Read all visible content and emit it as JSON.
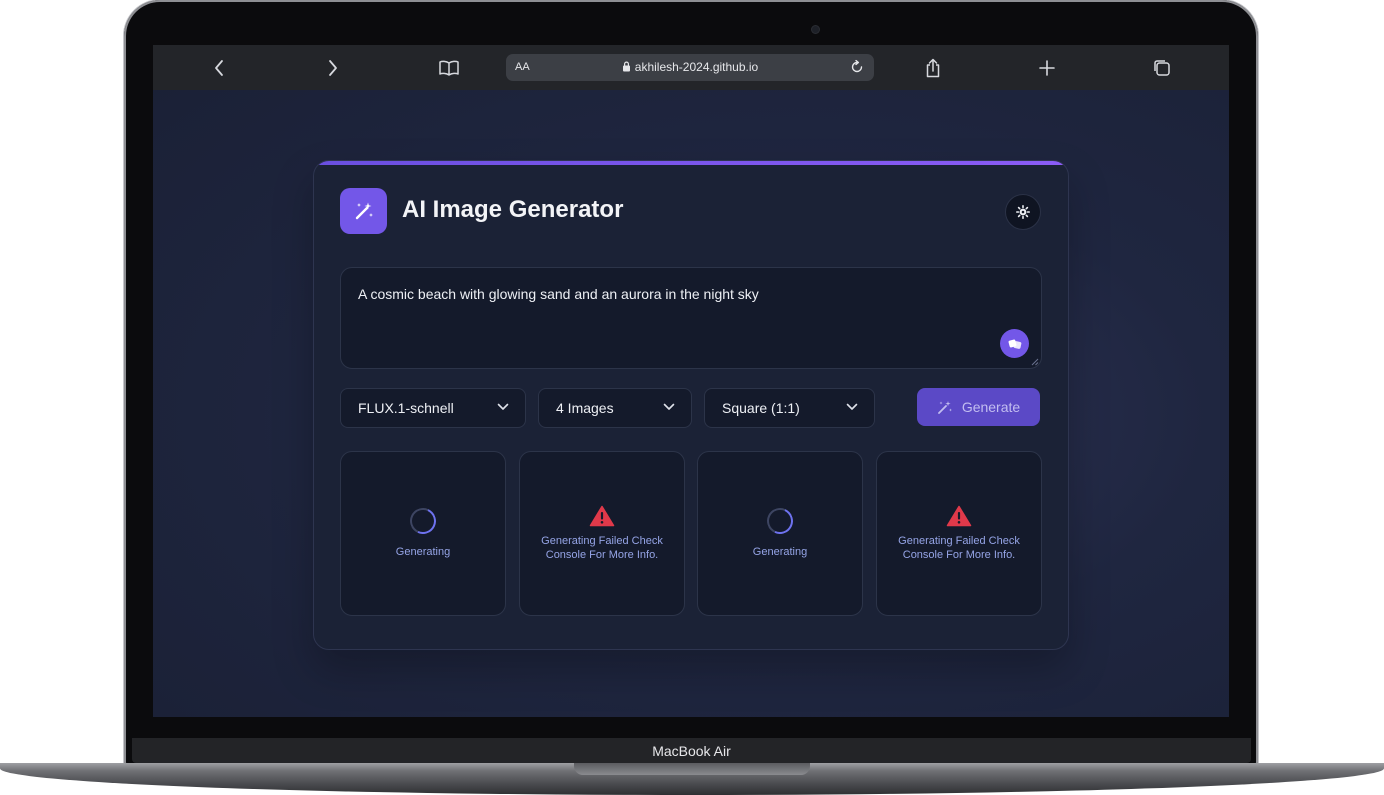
{
  "device": {
    "model_label": "MacBook Air"
  },
  "browser": {
    "url": "akhilesh-2024.github.io",
    "text_size_label": "AA"
  },
  "app": {
    "title": "AI Image Generator",
    "prompt_value": "A cosmic beach with glowing sand and an aurora in the night sky",
    "model_select": "FLUX.1-schnell",
    "count_select": "4 Images",
    "ratio_select": "Square (1:1)",
    "generate_label": "Generate",
    "accent_color": "#7357e8",
    "tiles": [
      {
        "status": "loading",
        "text": "Generating"
      },
      {
        "status": "error",
        "text": "Generating Failed Check Console For More Info."
      },
      {
        "status": "loading",
        "text": "Generating"
      },
      {
        "status": "error",
        "text": "Generating Failed Check Console For More Info."
      }
    ]
  },
  "icons": [
    "chevron-left-icon",
    "chevron-right-icon",
    "book-icon",
    "lock-icon",
    "reload-icon",
    "share-icon",
    "plus-icon",
    "tabs-icon",
    "magic-wand-icon",
    "gear-icon",
    "dice-icon",
    "chevron-down-icon",
    "warning-icon",
    "spinner-icon"
  ]
}
